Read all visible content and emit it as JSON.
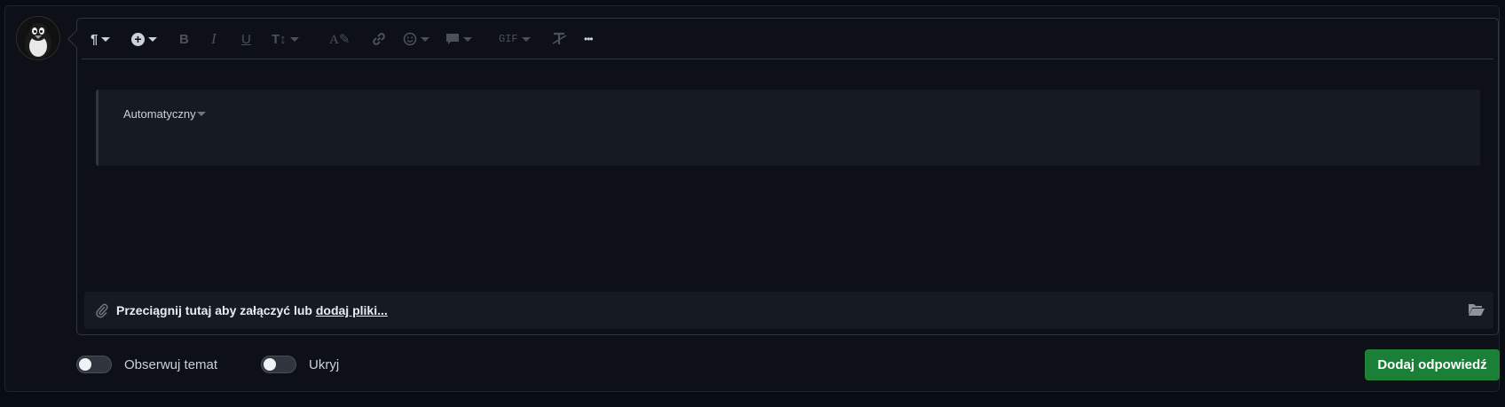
{
  "toolbar": {
    "items": [
      {
        "name": "paragraph-format-button",
        "icon": "pilcrow-icon",
        "glyph": "¶",
        "active": true,
        "caret": true
      },
      {
        "name": "insert-button",
        "icon": "plus-circle-icon",
        "glyph": "+",
        "active": true,
        "caret": true
      },
      {
        "name": "bold-button",
        "icon": "bold-icon",
        "glyph": "B",
        "active": false,
        "caret": false
      },
      {
        "name": "italic-button",
        "icon": "italic-icon",
        "glyph": "I",
        "active": false,
        "caret": false
      },
      {
        "name": "underline-button",
        "icon": "underline-icon",
        "glyph": "U",
        "active": false,
        "caret": false
      },
      {
        "name": "text-size-button",
        "icon": "text-size-icon",
        "glyph": "T↕",
        "active": false,
        "caret": true
      },
      {
        "name": "text-style-button",
        "icon": "text-style-icon",
        "glyph": "A✎",
        "active": false,
        "caret": false
      },
      {
        "name": "link-button",
        "icon": "link-icon",
        "glyph": "🔗",
        "active": false,
        "caret": false
      },
      {
        "name": "emoji-button",
        "icon": "smiley-icon",
        "glyph": "☺",
        "active": false,
        "caret": true
      },
      {
        "name": "quote-button",
        "icon": "speech-bubble-icon",
        "glyph": "💬",
        "active": false,
        "caret": true
      },
      {
        "name": "gif-button",
        "icon": "gif-icon",
        "glyph": "GIF",
        "active": false,
        "caret": true
      },
      {
        "name": "clear-format-button",
        "icon": "clear-format-icon",
        "glyph": "T̶",
        "active": false,
        "caret": false
      },
      {
        "name": "more-button",
        "icon": "ellipsis-icon",
        "glyph": "•••",
        "active": true,
        "caret": false
      }
    ]
  },
  "code_block": {
    "language": "Automatyczny"
  },
  "attach": {
    "text": "Przeciągnij tutaj aby załączyć lub ",
    "link": "dodaj pliki...",
    "icon": "paperclip-icon",
    "browse_icon": "folder-open-icon"
  },
  "options": {
    "watch_label": "Obserwuj temat",
    "hide_label": "Ukryj"
  },
  "submit_label": "Dodaj odpowiedź",
  "colors": {
    "accent": "#1a7f37",
    "background": "#0d1117",
    "panel": "#161b22"
  }
}
